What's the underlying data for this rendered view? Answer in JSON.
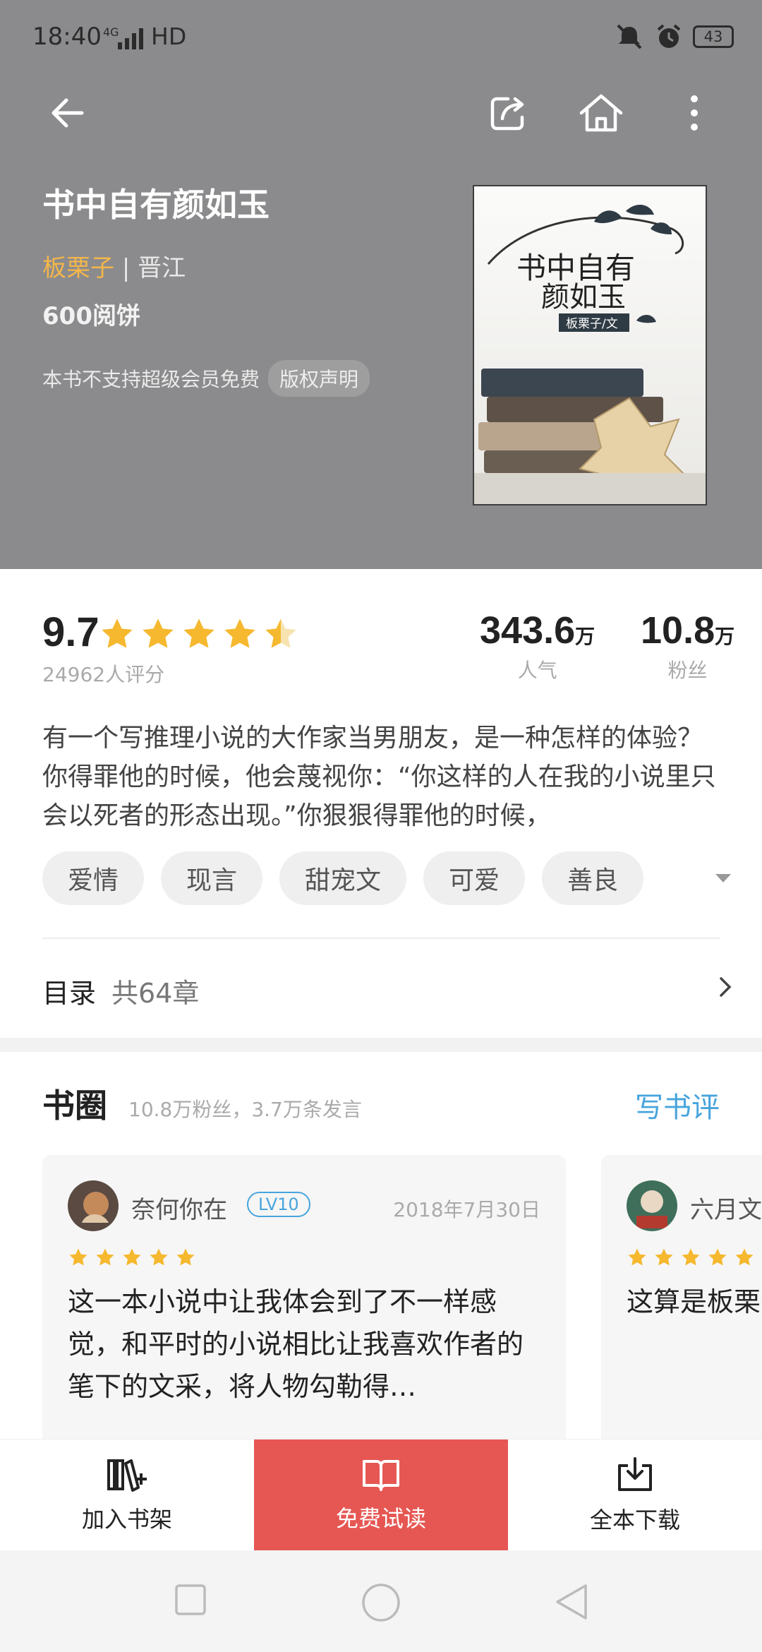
{
  "status_bar": {
    "time": "18:40",
    "network": "4G",
    "hd": "HD",
    "battery": "43"
  },
  "header": {
    "icons": [
      "back-arrow-icon",
      "share-icon",
      "home-icon",
      "more-icon"
    ],
    "book_title": "书中自有颜如玉",
    "author": "板栗子",
    "separator": "|",
    "source": "晋江",
    "price": "600阅饼",
    "notice": "本书不支持超级会员免费",
    "copyright_label": "版权声明",
    "cover_title_line1": "书中自有",
    "cover_title_line2": "颜如玉",
    "cover_author": "板栗子/文"
  },
  "rating": {
    "score": "9.7",
    "stars": 4.5,
    "count_text": "24962人评分",
    "popularity_value": "343.6",
    "popularity_unit": "万",
    "popularity_label": "人气",
    "fans_value": "10.8",
    "fans_unit": "万",
    "fans_label": "粉丝"
  },
  "description": "有一个写推理小说的大作家当男朋友，是一种怎样的体验？你得罪他的时候，他会蔑视你：“你这样的人在我的小说里只会以死者的形态出现。”你狠狠得罪他的时候，",
  "tags": [
    "爱情",
    "现言",
    "甜宠文",
    "可爱",
    "善良"
  ],
  "toc": {
    "label": "目录",
    "count": "共64章"
  },
  "book_circle": {
    "title": "书圈",
    "meta": "10.8万粉丝，3.7万条发言",
    "write_review": "写书评",
    "reviews": [
      {
        "user": "奈何你在",
        "level": "LV10",
        "date": "2018年7月30日",
        "stars": 5,
        "text": "这一本小说中让我体会到了不一样感觉，和平时的小说相比让我喜欢作者的笔下的文采，将人物勾勒得…"
      },
      {
        "user": "六月文",
        "stars": 5,
        "text": "这算是板栗平淡平凡的是非常的好"
      }
    ]
  },
  "actions": {
    "add_shelf": "加入书架",
    "free_read": "免费试读",
    "download": "全本下载"
  },
  "colors": {
    "header_bg": "#8b8b8d",
    "accent_red": "#e65753",
    "accent_blue": "#47a4dd",
    "author_gold": "#f3b64b",
    "star_gold": "#f5b82e"
  }
}
